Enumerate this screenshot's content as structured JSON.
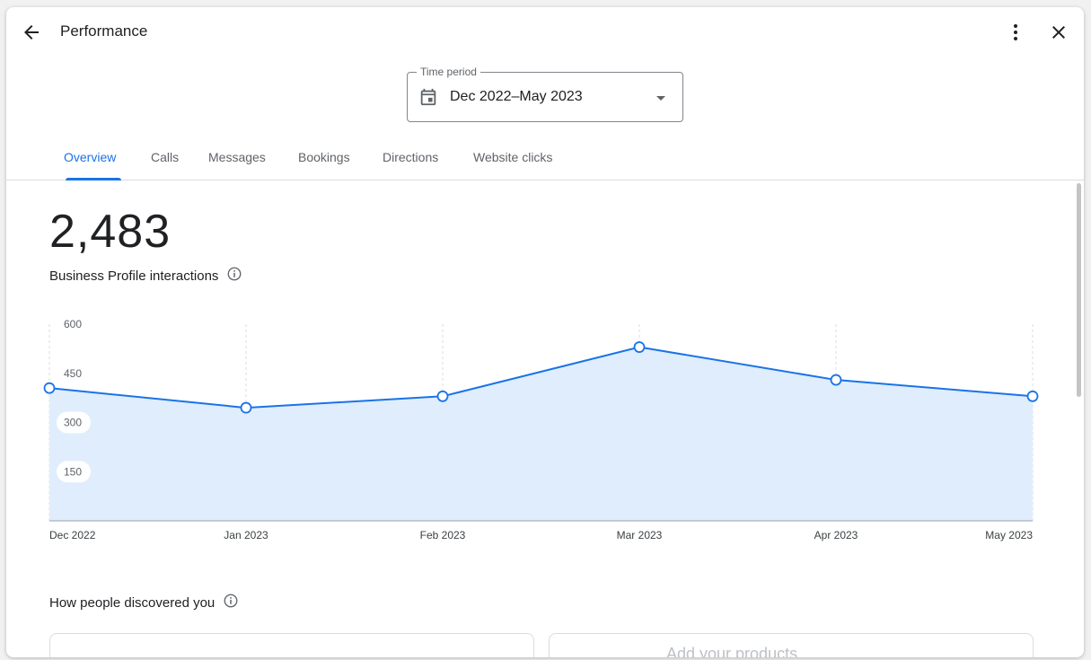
{
  "header": {
    "title": "Performance"
  },
  "time_period": {
    "label": "Time period",
    "value": "Dec 2022–May 2023"
  },
  "tabs": [
    {
      "label": "Overview",
      "active": true
    },
    {
      "label": "Calls"
    },
    {
      "label": "Messages"
    },
    {
      "label": "Bookings"
    },
    {
      "label": "Directions"
    },
    {
      "label": "Website clicks"
    }
  ],
  "summary": {
    "value": "2,483",
    "label": "Business Profile interactions"
  },
  "chart_data": {
    "type": "area",
    "x": [
      "Dec 2022",
      "Jan 2023",
      "Feb 2023",
      "Mar 2023",
      "Apr 2023",
      "May 2023"
    ],
    "y": [
      405,
      345,
      380,
      530,
      430,
      380
    ],
    "yticks": [
      600,
      450,
      300,
      150
    ],
    "ylim": [
      0,
      600
    ],
    "grid": true,
    "line_color": "#1a73e8",
    "fill_color": "#e0edfd"
  },
  "discovery": {
    "title": "How people discovered you",
    "card2_text": "Add your products"
  },
  "icons": {
    "back": "arrow-left-icon",
    "more": "more-vert-icon",
    "close": "close-icon",
    "calendar": "calendar-icon",
    "dropdown": "dropdown-arrow-icon",
    "info": "info-icon"
  }
}
